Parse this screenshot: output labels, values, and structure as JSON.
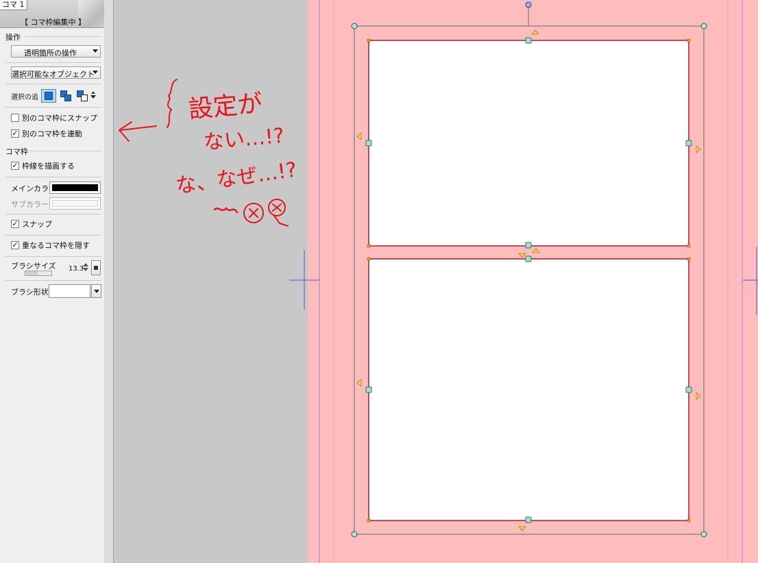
{
  "panel": {
    "tab_title": "コマ 1",
    "mode_label": "【 コマ枠編集中 】",
    "operation": {
      "heading": "操作",
      "transparent_dropdown": "透明箇所の操作",
      "selectable_dropdown": "選択可能なオブジェクト",
      "selection_label": "選択の追加"
    },
    "snap_other_frame": {
      "label": "別のコマ枠にスナップ",
      "checked": false
    },
    "link_other_frame": {
      "label": "別のコマ枠を連動",
      "checked": true
    },
    "frame": {
      "heading": "コマ枠",
      "draw_border": {
        "label": "枠線を描画する",
        "checked": true
      },
      "main_color_label": "メインカラー",
      "main_color": "#000000",
      "sub_color_label": "サブカラー",
      "snap": {
        "label": "スナップ",
        "checked": true
      },
      "hide_overlap": {
        "label": "重なるコマ枠を隠す",
        "checked": true
      },
      "brush_size_label": "ブラシサイズ",
      "brush_size_value": "13.3",
      "brush_shape_label": "ブラシ形状"
    },
    "check_mark": "✓"
  },
  "annotation": {
    "line1": "設定が",
    "line2": "ない…!?",
    "line3": "な、なぜ…!?",
    "color": "#e8141c"
  },
  "colors": {
    "page_pink": "#ffbcbc",
    "workspace_gray": "#c8c8c8",
    "frame_border": "#a0222a",
    "handle_teal": "#9fe0cf",
    "handle_yellow": "#f4d23c",
    "guide_blue": "#5555cc"
  }
}
